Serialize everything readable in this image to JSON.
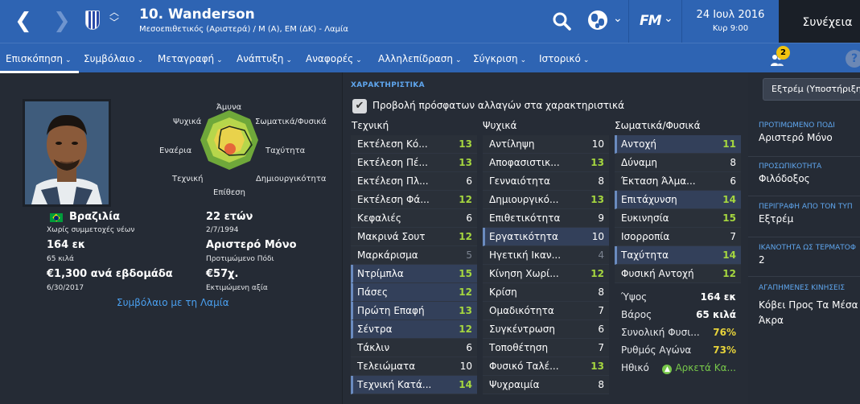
{
  "header": {
    "back_glyph": "❮",
    "forward_glyph": "❯",
    "player_name": "10. Wanderson",
    "player_subtitle": "Μεσοεπιθετικός (Αριστερά) / Μ (Α), ΕΜ (ΔΚ) - Λαμία",
    "date": "24 Ιουλ 2016",
    "time": "Κυρ 9:00",
    "fm_logo": "FM",
    "continue_label": "Συνέχεια"
  },
  "menu": {
    "items": [
      "Επισκόπηση",
      "Συμβόλαιο",
      "Μεταγραφή",
      "Ανάπτυξη",
      "Αναφορές",
      "Αλληλεπίδραση",
      "Σύγκριση",
      "Ιστορικό"
    ],
    "notification_count": "2",
    "help": "?"
  },
  "radar": {
    "labels": {
      "top": "Άμυνα",
      "left_top": "Ψυχικά",
      "right_top": "Σωματικά/Φυσικά",
      "left_mid": "Εναέρια",
      "right_mid": "Ταχύτητα",
      "left_bottom": "Τεχνική",
      "right_bottom": "Δημιουργικότητα",
      "bottom": "Επίθεση"
    },
    "colors": {
      "outer": "#6fa83a",
      "mid": "#b7d64b",
      "inner": "#e9d24b",
      "core": "#e5673a"
    }
  },
  "profile": {
    "nationality": "Βραζιλία",
    "youth_note": "Χωρίς συμμετοχές νέων",
    "height": "164 εκ",
    "weight": "65 κιλά",
    "wage": "€1,300 ανά εβδομάδα",
    "contract_end": "6/30/2017",
    "age": "22 ετών",
    "dob": "2/7/1994",
    "preferred_foot": "Αριστερό Μόνο",
    "preferred_foot_label": "Προτιμώμενο Πόδι",
    "value": "€57χ.",
    "value_label": "Εκτιμώμενη αξία",
    "contract_link": "Συμβόλαιο με τη Λαμία"
  },
  "attributes": {
    "section_title": "ΧΑΡΑΚΤΗΡΙΣΤΙΚΑ",
    "show_changes_label": "Προβολή πρόσφατων αλλαγών στα χαρακτηριστικά",
    "checked_glyph": "✔",
    "technical_title": "Τεχνική",
    "mental_title": "Ψυχικά",
    "physical_title": "Σωματικά/Φυσικά",
    "technical": [
      {
        "name": "Εκτέλεση Κό...",
        "value": "13",
        "hl": false
      },
      {
        "name": "Εκτέλεση Πέ...",
        "value": "13",
        "hl": false
      },
      {
        "name": "Εκτέλεση Πλ...",
        "value": "6",
        "hl": false
      },
      {
        "name": "Εκτέλεση Φά...",
        "value": "12",
        "hl": false
      },
      {
        "name": "Κεφαλιές",
        "value": "6",
        "hl": false
      },
      {
        "name": "Μακρινά Σουτ",
        "value": "12",
        "hl": false
      },
      {
        "name": "Μαρκάρισμα",
        "value": "5",
        "hl": false
      },
      {
        "name": "Ντρίμπλα",
        "value": "15",
        "hl": true
      },
      {
        "name": "Πάσες",
        "value": "12",
        "hl": true
      },
      {
        "name": "Πρώτη Επαφή",
        "value": "13",
        "hl": true
      },
      {
        "name": "Σέντρα",
        "value": "12",
        "hl": true
      },
      {
        "name": "Τάκλιν",
        "value": "6",
        "hl": false
      },
      {
        "name": "Τελειώματα",
        "value": "10",
        "hl": false
      },
      {
        "name": "Τεχνική Κατά...",
        "value": "14",
        "hl": true
      }
    ],
    "mental": [
      {
        "name": "Αντίληψη",
        "value": "10",
        "hl": false
      },
      {
        "name": "Αποφασιστικ...",
        "value": "13",
        "hl": false
      },
      {
        "name": "Γενναιότητα",
        "value": "8",
        "hl": false
      },
      {
        "name": "Δημιουργικό...",
        "value": "13",
        "hl": false
      },
      {
        "name": "Επιθετικότητα",
        "value": "9",
        "hl": false
      },
      {
        "name": "Εργατικότητα",
        "value": "10",
        "hl": true
      },
      {
        "name": "Ηγετική Ικαν...",
        "value": "4",
        "hl": false
      },
      {
        "name": "Κίνηση Χωρί...",
        "value": "12",
        "hl": false
      },
      {
        "name": "Κρίση",
        "value": "8",
        "hl": false
      },
      {
        "name": "Ομαδικότητα",
        "value": "7",
        "hl": false
      },
      {
        "name": "Συγκέντρωση",
        "value": "6",
        "hl": false
      },
      {
        "name": "Τοποθέτηση",
        "value": "7",
        "hl": false
      },
      {
        "name": "Φυσικό Ταλέ...",
        "value": "13",
        "hl": false
      },
      {
        "name": "Ψυχραιμία",
        "value": "8",
        "hl": false
      }
    ],
    "physical": [
      {
        "name": "Αντοχή",
        "value": "11",
        "hl": true
      },
      {
        "name": "Δύναμη",
        "value": "8",
        "hl": false
      },
      {
        "name": "Έκταση Άλμα...",
        "value": "6",
        "hl": false
      },
      {
        "name": "Επιτάχυνση",
        "value": "14",
        "hl": true
      },
      {
        "name": "Ευκινησία",
        "value": "15",
        "hl": false
      },
      {
        "name": "Ισορροπία",
        "value": "7",
        "hl": false
      },
      {
        "name": "Ταχύτητα",
        "value": "14",
        "hl": true
      },
      {
        "name": "Φυσική Αντοχή",
        "value": "12",
        "hl": false
      }
    ],
    "extra": [
      {
        "name": "Ύψος",
        "value": "164 εκ",
        "color": "w"
      },
      {
        "name": "Βάρος",
        "value": "65 κιλά",
        "color": "w"
      },
      {
        "name": "Συνολική Φυσι...",
        "value": "76%",
        "color": "y"
      },
      {
        "name": "Ρυθμός Αγώνα",
        "value": "73%",
        "color": "y"
      }
    ],
    "morale_label": "Ηθικό",
    "morale_value": "Αρκετά Κα..."
  },
  "sidebar": {
    "role_button": "Εξτρέμ (Υποστήριξη)",
    "fields": [
      {
        "label": "ΠΡΟΤΙΜΩΜΕΝΟ ΠΟΔΙ",
        "value": "Αριστερό Μόνο"
      },
      {
        "label": "ΠΡΟΣΩΠΙΚΟΤΗΤΑ",
        "value": "Φιλόδοξος"
      },
      {
        "label": "ΠΕΡΙΓΡΑΦΗ ΑΠΟ ΤΟΝ ΤΥΠ",
        "value": "Εξτρέμ"
      },
      {
        "label": "ΙΚΑΝΟΤΗΤΑ ΩΣ ΤΕΡΜΑΤΟΦ",
        "value": "2"
      },
      {
        "label": "ΑΓΑΠΗΜΕΝΕΣ ΚΙΝΗΣΕΙΣ",
        "value": "Κόβει Προς Τα Μέσα Α"
      },
      {
        "label": "",
        "value": "Άκρα"
      }
    ]
  }
}
